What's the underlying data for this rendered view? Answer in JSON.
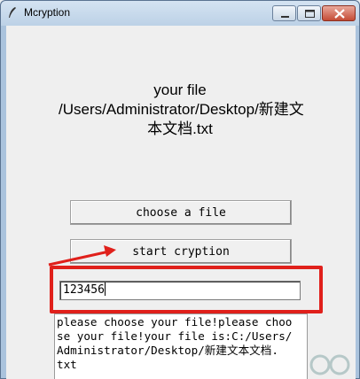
{
  "window": {
    "title": "Mcryption",
    "icon": "feather-icon"
  },
  "controls": {
    "minimize_icon": "minimize-icon",
    "maximize_icon": "maximize-icon",
    "close_icon": "close-icon"
  },
  "file_label": {
    "line1": "your file",
    "line2": "/Users/Administrator/Desktop/新建文",
    "line3": "本文档.txt"
  },
  "buttons": {
    "choose_label": "choose a file",
    "start_label": "start cryption"
  },
  "entry": {
    "value": "123456"
  },
  "log": {
    "lines": [
      "please choose your file!please choo",
      "se your file!your file is:C:/Users/",
      "Administrator/Desktop/新建文本文档.",
      "txt"
    ]
  },
  "colors": {
    "highlight": "#e0201b",
    "arrow": "#e0201b"
  }
}
